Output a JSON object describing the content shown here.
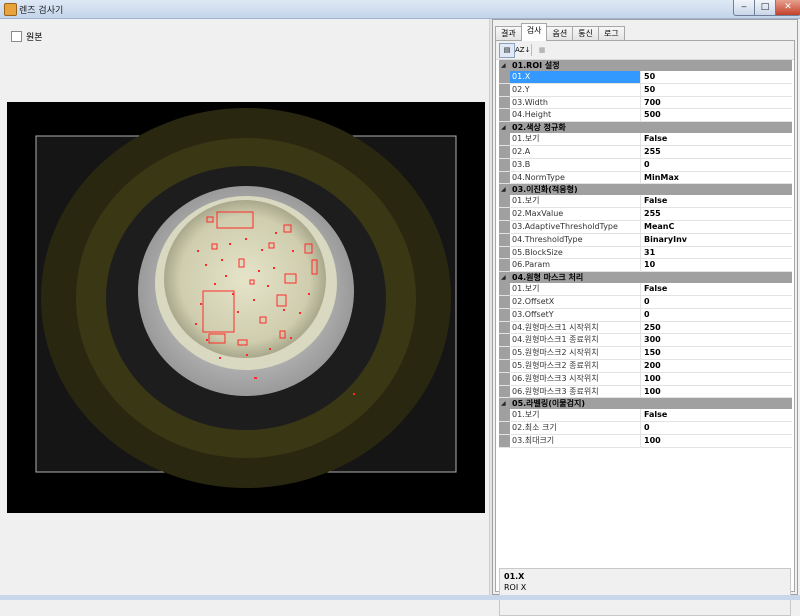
{
  "window": {
    "title": "렌즈 검사기",
    "min_label": "‒",
    "max_label": "□",
    "close_label": "✕"
  },
  "left": {
    "checkbox_label": "원본",
    "checkbox_checked": false
  },
  "tabs": [
    {
      "label": "결과",
      "active": false
    },
    {
      "label": "검사",
      "active": true
    },
    {
      "label": "옵션",
      "active": false
    },
    {
      "label": "통신",
      "active": false
    },
    {
      "label": "로그",
      "active": false
    }
  ],
  "toolbar": {
    "categorized_icon": "categorized-icon",
    "alphabetical_icon": "alphabetical-icon",
    "pages_icon": "property-pages-icon",
    "alpha_label": "AZ↓"
  },
  "property_grid": [
    {
      "category": "01.ROI 설정",
      "rows": [
        {
          "name": "01.X",
          "value": "50",
          "selected": true
        },
        {
          "name": "02.Y",
          "value": "50"
        },
        {
          "name": "03.Width",
          "value": "700"
        },
        {
          "name": "04.Height",
          "value": "500"
        }
      ]
    },
    {
      "category": "02.색상 정규화",
      "rows": [
        {
          "name": "01.보기",
          "value": "False"
        },
        {
          "name": "02.A",
          "value": "255"
        },
        {
          "name": "03.B",
          "value": "0"
        },
        {
          "name": "04.NormType",
          "value": "MinMax"
        }
      ]
    },
    {
      "category": "03.이진화(적응형)",
      "rows": [
        {
          "name": "01.보기",
          "value": "False"
        },
        {
          "name": "02.MaxValue",
          "value": "255"
        },
        {
          "name": "03.AdaptiveThresholdType",
          "value": "MeanC"
        },
        {
          "name": "04.ThresholdType",
          "value": "BinaryInv"
        },
        {
          "name": "05.BlockSize",
          "value": "31"
        },
        {
          "name": "06.Param",
          "value": "10"
        }
      ]
    },
    {
      "category": "04.원형 마스크 처리",
      "rows": [
        {
          "name": "01.보기",
          "value": "False"
        },
        {
          "name": "02.OffsetX",
          "value": "0"
        },
        {
          "name": "03.OffsetY",
          "value": "0"
        },
        {
          "name": "04.원형마스크1 시작위치",
          "value": "250"
        },
        {
          "name": "04.원형마스크1 종료위치",
          "value": "300"
        },
        {
          "name": "05.원형마스크2 시작위치",
          "value": "150"
        },
        {
          "name": "05.원형마스크2 종료위치",
          "value": "200"
        },
        {
          "name": "06.원형마스크3 시작위치",
          "value": "100"
        },
        {
          "name": "06.원형마스크3 종료위치",
          "value": "100"
        }
      ]
    },
    {
      "category": "05.라벨링(이물검지)",
      "rows": [
        {
          "name": "01.보기",
          "value": "False"
        },
        {
          "name": "02.최소 크기",
          "value": "0"
        },
        {
          "name": "03.최대크기",
          "value": "100"
        }
      ]
    }
  ],
  "help": {
    "title": "01.X",
    "description": "ROI X"
  },
  "colors": {
    "detection": "#ff2a2a",
    "category_bg": "#a0a0a0",
    "selection": "#3399ff"
  }
}
